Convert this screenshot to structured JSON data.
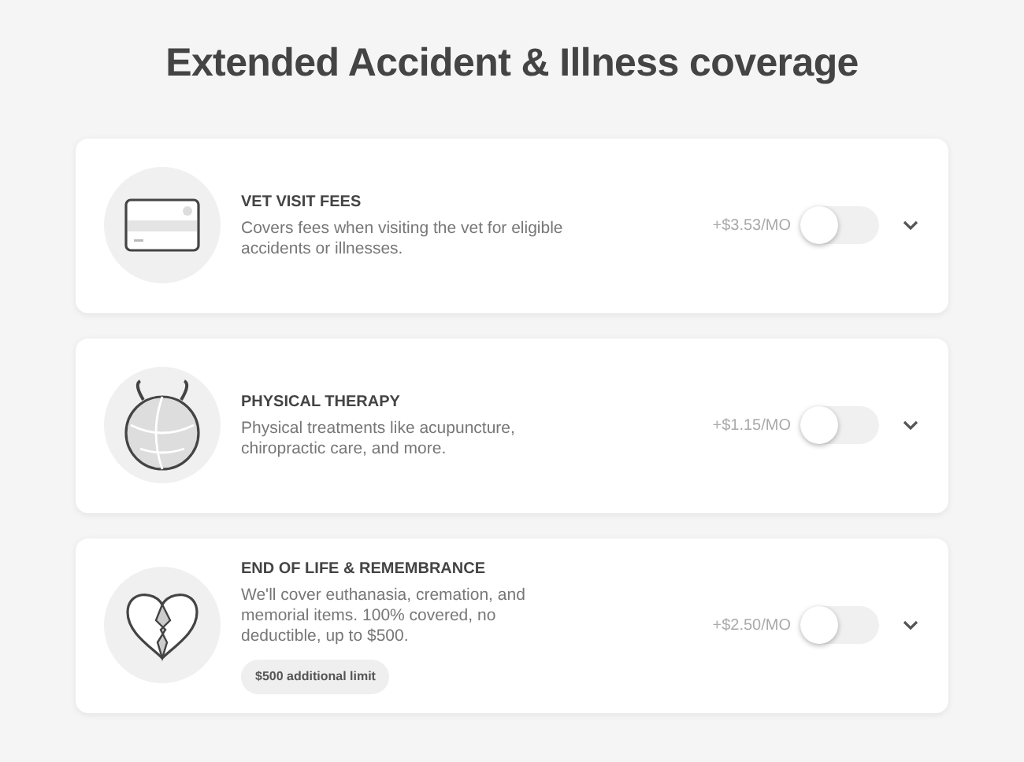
{
  "title": "Extended Accident & Illness coverage",
  "options": [
    {
      "kind": "card",
      "name": "VET VISIT FEES",
      "description": "Covers fees when visiting the vet for eligible accidents or illnesses.",
      "price": "+$3.53/MO",
      "on": false,
      "expanded": false
    },
    {
      "kind": "ball",
      "name": "PHYSICAL THERAPY",
      "description": "Physical treatments like acupuncture, chiropractic care, and more.",
      "price": "+$1.15/MO",
      "on": false,
      "expanded": false
    },
    {
      "kind": "heart",
      "name": "END OF LIFE & REMEMBRANCE",
      "description": "We'll cover euthanasia, cremation, and memorial items. 100% covered, no deductible, up to $500.",
      "tag": "$500 additional limit",
      "price": "+$2.50/MO",
      "on": false,
      "expanded": false
    }
  ]
}
